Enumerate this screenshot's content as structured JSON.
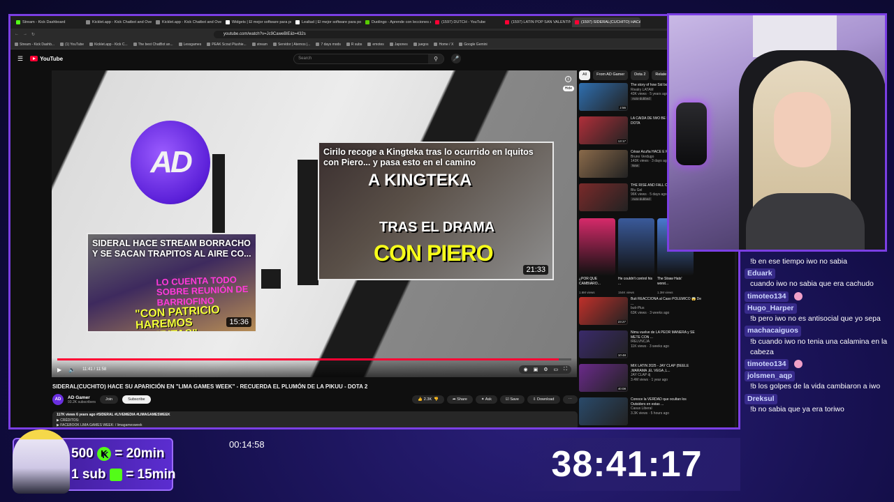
{
  "browser": {
    "tabs": [
      {
        "label": "Stream - Kick Dashboard",
        "color": "#53fc18"
      },
      {
        "label": "Kicklet.app - Kick Chatbot and Overl",
        "color": "#888888"
      },
      {
        "label": "Kicklet.app - Kick Chatbot and Overl",
        "color": "#888888"
      },
      {
        "label": "Widgets | El mejor software para pot",
        "color": "#ffffff"
      },
      {
        "label": "Lealtad | El mejor software para pot",
        "color": "#ffffff"
      },
      {
        "label": "Duolingo - Aprende con lecciones a",
        "color": "#58cc02"
      },
      {
        "label": "(1597) DUTCH - YouTube",
        "color": "#ff0033"
      },
      {
        "label": "(1597) LATIN POP SAN VALENTIN 20",
        "color": "#ff0033"
      },
      {
        "label": "(1597) SIDERAL(CUCHITO) HACé",
        "color": "#ff0033"
      }
    ],
    "url": "youtube.com/watch?v=Jc9CaweBlE&t=432s",
    "bookmarks": [
      "Stream - Kick Dashb...",
      "(1) YouTube",
      "Kicklet.app - Kick C...",
      "The best ChatBot an...",
      "Lessgames",
      "PEAK Scout Plushie...",
      "stream",
      "Servidor | Aternos |...",
      "7 days mods",
      "R subs",
      "emotes",
      "Japones",
      "juegos",
      "Home / X",
      "Google Gemini"
    ]
  },
  "youtube": {
    "logo": "YouTube",
    "search_placeholder": "Search"
  },
  "player": {
    "time": "11:41 / 11:58",
    "progress_fraction": 0.976,
    "hide_label": "Hide",
    "endcard_left": {
      "title": "SIDERAL HACE STREAM BORRACHO Y SE SACAN TRAPITOS AL AIRE CO...",
      "duration": "15:36",
      "text1": "LO CUENTA TODO SOBRE REUNIÓN DE BARRIOFINO",
      "text2": "\"CON PATRICIO HAREMOS TIJERITAS\""
    },
    "endcard_right": {
      "title": "Cirilo recoge a Kingteka tras lo ocurrido en Iquitos con Piero... y pasa esto en el camino",
      "duration": "21:33",
      "text_top": "A KINGTEKA",
      "text_mid": "TRAS EL DRAMA",
      "text_big": "CON PIERO"
    }
  },
  "video": {
    "title": "SIDERAL(CUCHITO) HACE SU APARICIÓN EN \"LIMA GAMES WEEK\" - RECUERDA EL PLUMÓN DE LA PIKUU - DOTA 2",
    "channel": "AD Gamer",
    "subscribers": "93.2K subscribers",
    "join": "Join",
    "subscribe": "Subscribe",
    "likes": "2.3K",
    "share": "Share",
    "ask": "Ask",
    "save": "Save",
    "download": "Download",
    "desc_line1": "117K views  6 years ago  #SIDERAL #LIVEMEDIA #LIMAGAMESWEEK",
    "desc_line2": "▶ CRÉDITOS:",
    "desc_line3": "▶ FACEBOOK LIMA GAMES WEEK: / limagamesweek"
  },
  "sidebar": {
    "chips": [
      "All",
      "From AD Gamer",
      "Dota 2",
      "Relate"
    ],
    "recs": [
      {
        "title": "The story of how Sid born 🥉 | Rivalry Ex",
        "channel": "Rivalry LATAM",
        "views": "43K views · 5 years ago",
        "badge": "Auto-dubbed",
        "duration": "2:56",
        "color": "#2f6fb0"
      },
      {
        "title": "LA CAÍDA DE IWO BE STREAMER DE DOTA",
        "channel": "",
        "views": "",
        "badge": "",
        "duration": "13:17",
        "color": "#b02f3a"
      },
      {
        "title": "César Acuña HACE E RIDÍCULO en DEBAT",
        "channel": "Bruno Verdugo",
        "views": "143K views · 3 days ago",
        "badge": "New",
        "duration": "",
        "color": "#8a6a4a"
      },
      {
        "title": "THE RISE AND FALL CARLOS ALCÁNTAR",
        "channel": "Blu Gel",
        "views": "96K views · 5 days ago",
        "badge": "Auto-dubbed",
        "duration": "",
        "color": "#7a2a2a"
      }
    ],
    "shorts": [
      {
        "title": "¿POR QUE CAMBIARO...",
        "views": "1.6M views",
        "color": "#d62a6a"
      },
      {
        "title": "He couldn't control his ...",
        "views": "154K views",
        "color": "#3a5a9a"
      },
      {
        "title": "The Straw Hats' worst...",
        "views": "1.3M views",
        "color": "#4a7ad0"
      }
    ],
    "recs2": [
      {
        "title": "Buti REACCIONA al Caso POLEMICO 😱 De ...",
        "channel": "buti-Plus",
        "views": "63K views · 3 weeks ago",
        "duration": "23:27",
        "color": "#c0302a"
      },
      {
        "title": "Nimu vuelve de LA PEOR MANERA y SE METE CON ...",
        "channel": "IRELVNCJA",
        "views": "11K views · 3 weeks ago",
        "duration": "10:48",
        "color": "#3a2a6a"
      },
      {
        "title": "MIX LATIN 2025 - JAY CLAP (BEELE ,MARAMA ,EL VEGA ,L...",
        "channel": "JAY CLAP dj",
        "views": "3.4M views · 1 year ago",
        "duration": "40:08",
        "color": "#6a2a8a"
      },
      {
        "title": "Conoce la VERDAD que ocultan los Outsiders en estas ...",
        "channel": "Casus Liberal",
        "views": "3.3K views · 5 hours ago",
        "duration": "",
        "color": "#2a4a6a"
      }
    ]
  },
  "chat": [
    {
      "user": "",
      "text": "!b en ese tiempo iwo no sabia"
    },
    {
      "user": "Eduark",
      "text": "cuando iwo no sabia que era cachudo"
    },
    {
      "user": "timoteo134",
      "text": ""
    },
    {
      "user": "Hugo_Harper",
      "text": "!b pero iwo no es antisocial que yo sepa"
    },
    {
      "user": "machacaiguos",
      "text": "!b cuando iwo no tenia una calamina en la cabeza"
    },
    {
      "user": "timoteo134",
      "text": ""
    },
    {
      "user": "jolsmen_aqp",
      "text": "!b los golpes de la vida cambiaron a iwo"
    },
    {
      "user": "Dreksul",
      "text": "!b no sabia que ya era toriwo"
    }
  ],
  "overlay": {
    "goal_line1_num": "500",
    "goal_line1_eq": "= 20min",
    "goal_line2": "1 sub",
    "goal_line2_eq": "= 15min",
    "k_letter": "K",
    "elapsed": "00:14:58",
    "countdown": "38:41:17"
  }
}
